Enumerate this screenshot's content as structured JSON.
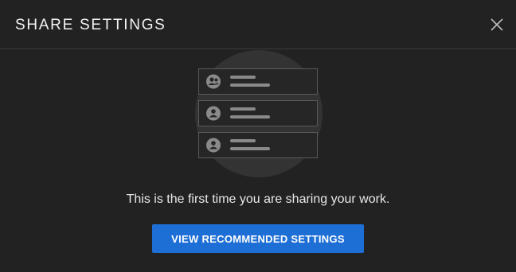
{
  "dialog": {
    "title": "SHARE SETTINGS",
    "close_icon": "close-icon",
    "message": "This is the first time you are sharing your work.",
    "cta_label": "VIEW RECOMMENDED SETTINGS"
  },
  "illustration": {
    "icons": [
      "group-icon",
      "person-icon",
      "person-icon"
    ]
  },
  "colors": {
    "background": "#222222",
    "accent": "#1d6fd6",
    "divider": "#3a3a3a"
  }
}
